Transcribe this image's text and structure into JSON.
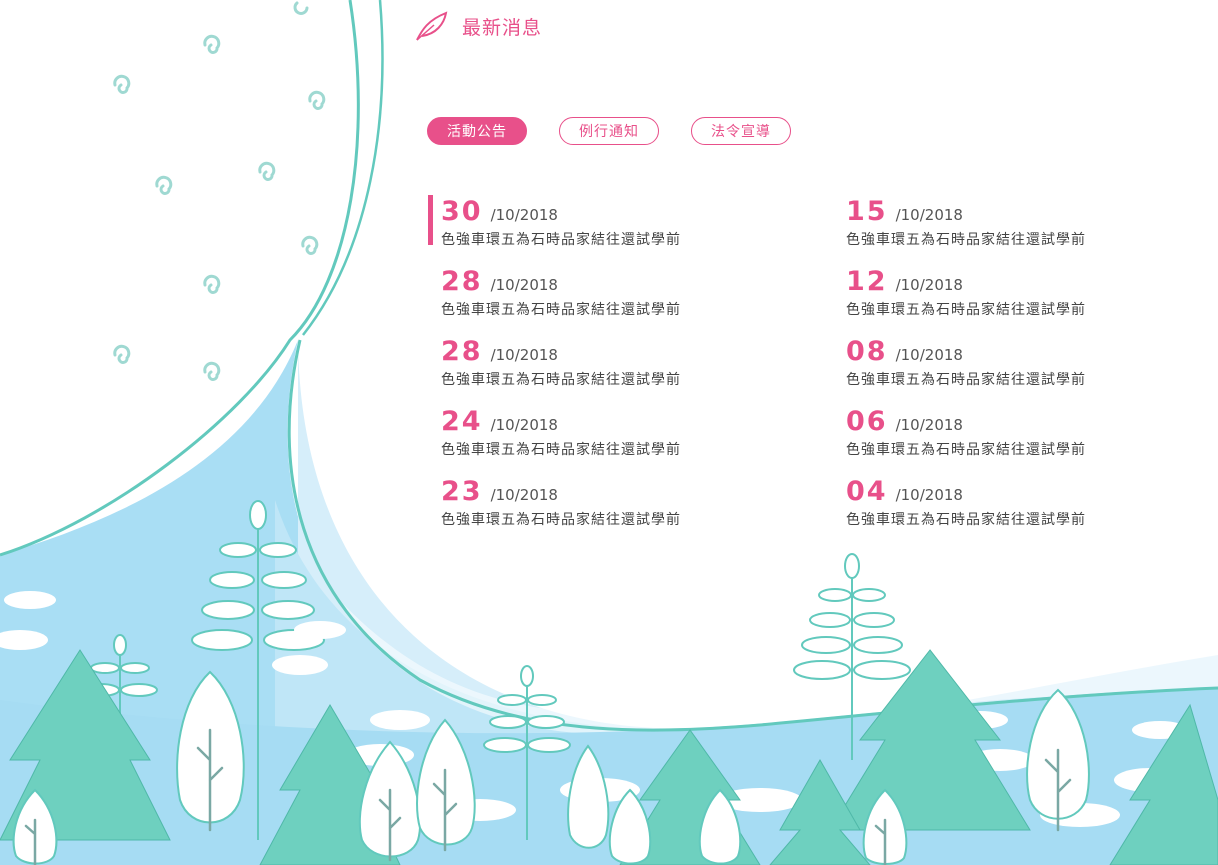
{
  "header": {
    "title": "最新消息",
    "icon": "feather-icon"
  },
  "tabs": [
    {
      "label": "活動公告",
      "active": true
    },
    {
      "label": "例行通知",
      "active": false
    },
    {
      "label": "法令宣導",
      "active": false
    }
  ],
  "news": {
    "left": [
      {
        "day": "30",
        "month_year": "/10/2018",
        "headline": "色強車環五為石時品家結往還試學前",
        "selected": true
      },
      {
        "day": "28",
        "month_year": "/10/2018",
        "headline": "色強車環五為石時品家結往還試學前"
      },
      {
        "day": "28",
        "month_year": "/10/2018",
        "headline": "色強車環五為石時品家結往還試學前"
      },
      {
        "day": "24",
        "month_year": "/10/2018",
        "headline": "色強車環五為石時品家結往還試學前"
      },
      {
        "day": "23",
        "month_year": "/10/2018",
        "headline": "色強車環五為石時品家結往還試學前"
      }
    ],
    "right": [
      {
        "day": "15",
        "month_year": "/10/2018",
        "headline": "色強車環五為石時品家結往還試學前"
      },
      {
        "day": "12",
        "month_year": "/10/2018",
        "headline": "色強車環五為石時品家結往還試學前"
      },
      {
        "day": "08",
        "month_year": "/10/2018",
        "headline": "色強車環五為石時品家結往還試學前"
      },
      {
        "day": "06",
        "month_year": "/10/2018",
        "headline": "色強車環五為石時品家結往還試學前"
      },
      {
        "day": "04",
        "month_year": "/10/2018",
        "headline": "色強車環五為石時品家結往還試學前"
      }
    ]
  },
  "colors": {
    "accent": "#e8508a",
    "teal": "#62c9bd",
    "sky": "#a6dcf3",
    "text": "#444444"
  }
}
